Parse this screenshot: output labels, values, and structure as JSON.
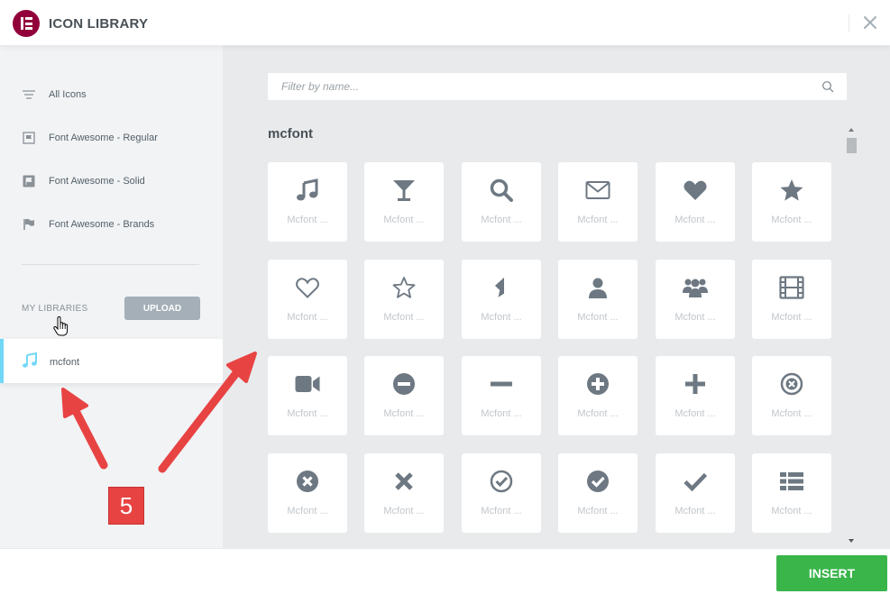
{
  "header": {
    "title": "ICON LIBRARY"
  },
  "sidebar": {
    "items": [
      {
        "label": "All Icons",
        "icon": "lines-icon"
      },
      {
        "label": "Font Awesome - Regular",
        "icon": "flag-regular-icon"
      },
      {
        "label": "Font Awesome - Solid",
        "icon": "flag-solid-icon"
      },
      {
        "label": "Font Awesome - Brands",
        "icon": "flag-brands-icon"
      }
    ],
    "my_libraries_label": "MY LIBRARIES",
    "upload_label": "UPLOAD",
    "active_library": {
      "label": "mcfont",
      "icon": "music-icon"
    }
  },
  "main": {
    "search": {
      "placeholder": "Filter by name..."
    },
    "section_title": "mcfont",
    "tile_label": "Mcfont ...",
    "icons": [
      "music-icon",
      "glass-icon",
      "search-icon",
      "envelope-icon",
      "heart-icon",
      "star-icon",
      "heart-outline-icon",
      "star-outline-icon",
      "star-half-icon",
      "user-icon",
      "users-icon",
      "film-icon",
      "video-camera-icon",
      "minus-circle-icon",
      "minus-icon",
      "plus-circle-icon",
      "plus-icon",
      "times-circle-outline-icon",
      "times-circle-icon",
      "times-icon",
      "check-circle-outline-icon",
      "check-circle-icon",
      "check-icon",
      "list-icon"
    ]
  },
  "footer": {
    "insert_label": "INSERT"
  },
  "annotation": {
    "step_number": "5"
  },
  "colors": {
    "brand": "#92003b",
    "accent_active": "#71d7f7",
    "insert_green": "#39b54a",
    "icon_gray": "#6d7882",
    "annotation_red": "#e84343"
  }
}
